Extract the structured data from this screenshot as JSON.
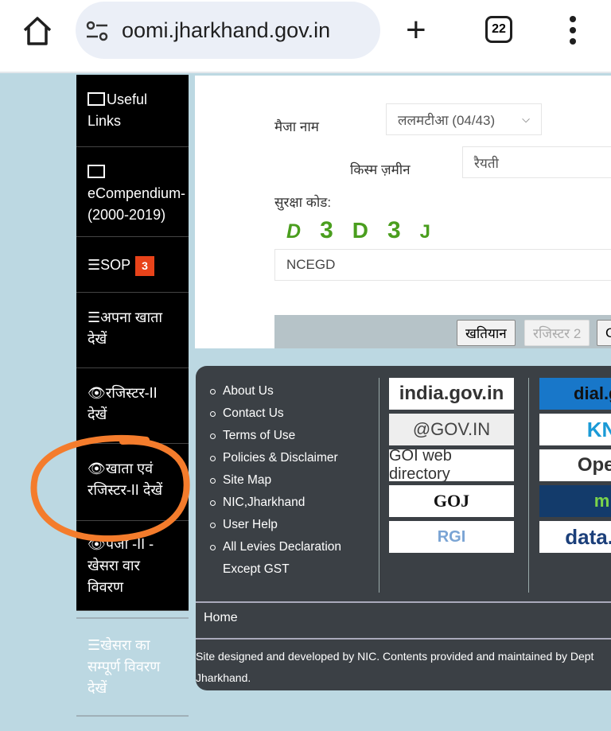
{
  "browser": {
    "url": "oomi.jharkhand.gov.in",
    "tab_count": "22"
  },
  "sidebar": {
    "items": [
      {
        "label": "Useful",
        "label2": "Links",
        "icon": "bar-chart-icon"
      },
      {
        "label": "eCompendium-",
        "label2": "(2000-2019)",
        "icon": "bar-chart-icon"
      },
      {
        "label": "SOP",
        "badge": "3",
        "icon": "list-icon"
      },
      {
        "label": "अपना खाता",
        "label2": "देखें",
        "icon": "list-icon"
      },
      {
        "label": "रजिस्टर-II",
        "label2": "देखें",
        "icon": "eye-icon"
      },
      {
        "label": "खाता एवं",
        "label2": "रजिस्टर-II देखें",
        "icon": "eye-icon"
      },
      {
        "label": "पंजी -II -",
        "label2": "खेसरा वार",
        "label3": "विवरण",
        "icon": "eye-icon"
      },
      {
        "label": "खेसरा का",
        "label2": "सम्पूर्ण विवरण",
        "label3": "देखें",
        "icon": "list-icon"
      }
    ]
  },
  "form": {
    "mauja_label": "मैजा नाम",
    "mauja_value": "ललमटीआ (04/43)",
    "kism_label": "किस्म ज़मीन",
    "kism_value": "रैयती",
    "captcha_label": "सुरक्षा कोड:",
    "captcha_chars": [
      "D",
      "3",
      "D",
      "3",
      "J"
    ],
    "captcha_input": "NCEGD",
    "buttons": [
      "खतियान",
      "रजिस्टर 2",
      "C"
    ]
  },
  "footer": {
    "links": [
      "About Us",
      "Contact Us",
      "Terms of Use",
      "Policies & Disclaimer",
      "Site Map",
      "NIC,Jharkhand",
      "User Help",
      "All Levies Declaration Except GST"
    ],
    "logos_left": [
      "india.gov.in",
      "@GOV.IN",
      "GOI web directory",
      "GOJ",
      "RGI"
    ],
    "logos_right": [
      "dial.go",
      "KN",
      "Open",
      "m",
      "data.go"
    ],
    "home": "Home",
    "credit1": "Site designed and developed by NIC. Contents provided and maintained by Dept",
    "credit2": "Jharkhand."
  },
  "colors": {
    "annotation": "#f47c2c",
    "badge": "#e8431a",
    "captcha": "#4a9e1e"
  }
}
